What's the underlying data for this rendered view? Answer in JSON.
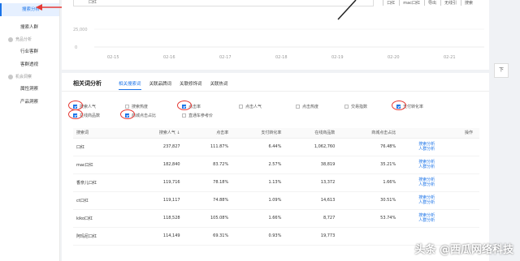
{
  "sidebar": {
    "items": [
      {
        "label": "搜索分析",
        "type": "item",
        "active": true
      },
      {
        "label": "搜索人群",
        "type": "item"
      },
      {
        "label": "竞品分析",
        "type": "group"
      },
      {
        "label": "行业客群",
        "type": "item"
      },
      {
        "label": "客群透视",
        "type": "item"
      },
      {
        "label": "机会洞察",
        "type": "group"
      },
      {
        "label": "属性洞察",
        "type": "item"
      },
      {
        "label": "产品洞察",
        "type": "item"
      }
    ]
  },
  "top": {
    "search_value": "口红",
    "tools": [
      "口红",
      "mac口红",
      "导出",
      "无线引",
      "搜索"
    ]
  },
  "trend_chart": {
    "y_tick": "25,000",
    "y_zero": "0",
    "x_ticks": [
      "02-15",
      "02-16",
      "02-17",
      "02-18",
      "02-19",
      "02-20",
      "02-21"
    ]
  },
  "related": {
    "title": "相关词分析",
    "tabs": [
      "相关搜索词",
      "关联品牌词",
      "关联修饰词",
      "关联热词"
    ],
    "options": [
      {
        "label": "搜索人气",
        "checked": true
      },
      {
        "label": "搜索热度",
        "checked": false
      },
      {
        "label": "点击率",
        "checked": true
      },
      {
        "label": "点击人气",
        "checked": false
      },
      {
        "label": "点击热度",
        "checked": false
      },
      {
        "label": "交易指数",
        "checked": false
      },
      {
        "label": "支付转化率",
        "checked": true
      },
      {
        "label": "在线商品数",
        "checked": true
      },
      {
        "label": "商城点击占比",
        "checked": true
      },
      {
        "label": "直通车参考价",
        "checked": false
      }
    ],
    "columns": [
      "搜索词",
      "搜索人气 ↓",
      "点击率",
      "支付转化率",
      "在线商品数",
      "商城点击占比",
      "操作"
    ],
    "rows": [
      [
        "口红",
        "237,827",
        "111.87%",
        "6.44%",
        "1,062,760",
        "76.48%"
      ],
      [
        "mac口红",
        "182,840",
        "83.72%",
        "2.57%",
        "38,819",
        "35.21%"
      ],
      [
        "香奈儿口红",
        "119,716",
        "78.18%",
        "1.13%",
        "13,372",
        "1.66%"
      ],
      [
        "ct口红",
        "119,117",
        "74.88%",
        "1.09%",
        "14,613",
        "30.51%"
      ],
      [
        "kiko口红",
        "118,528",
        "105.08%",
        "1.66%",
        "8,727",
        "53.74%"
      ],
      [
        "阿玛尼口红",
        "114,149",
        "69.31%",
        "0.93%",
        "19,773",
        ""
      ]
    ],
    "row_actions": [
      "搜索分析",
      "人群分析"
    ]
  },
  "side_button": "下",
  "watermark": "头条 @西瓜网络科技",
  "colors": {
    "accent": "#1a73e8",
    "annotation": "#e53935"
  }
}
